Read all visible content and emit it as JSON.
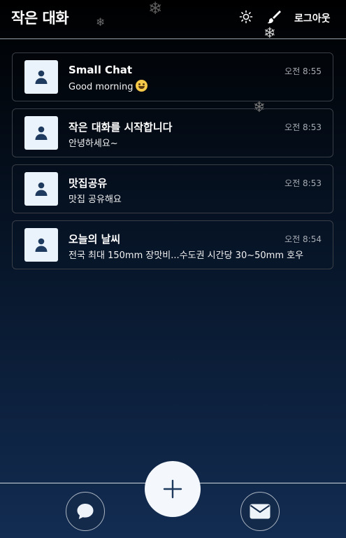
{
  "header": {
    "title": "작은 대화",
    "theme_icon": "sun-icon",
    "brush_icon": "brush-icon",
    "logout_label": "로그아웃"
  },
  "chats": [
    {
      "name": "Small Chat",
      "message": "Good morning",
      "emoji": "grinning-face-emoji",
      "time": "오전 8:55"
    },
    {
      "name": "작은 대화를 시작합니다",
      "message": "안녕하세요~",
      "time": "오전 8:53"
    },
    {
      "name": "맛집공유",
      "message": "맛집 공유해요",
      "time": "오전 8:53"
    },
    {
      "name": "오늘의 날씨",
      "message": "전국 최대 150mm 장맛비...수도권 시간당 30~50mm 호우",
      "time": "오전 8:54"
    }
  ],
  "bottom_nav": {
    "chat_icon": "chat-bubble-icon",
    "add_icon": "plus-icon",
    "mail_icon": "envelope-icon"
  },
  "colors": {
    "background_top": "#000000",
    "background_bottom": "#122c52",
    "avatar_bg": "#eaf3fc",
    "avatar_fg": "#1e3a5f",
    "accent_light": "#f4f7fb"
  }
}
